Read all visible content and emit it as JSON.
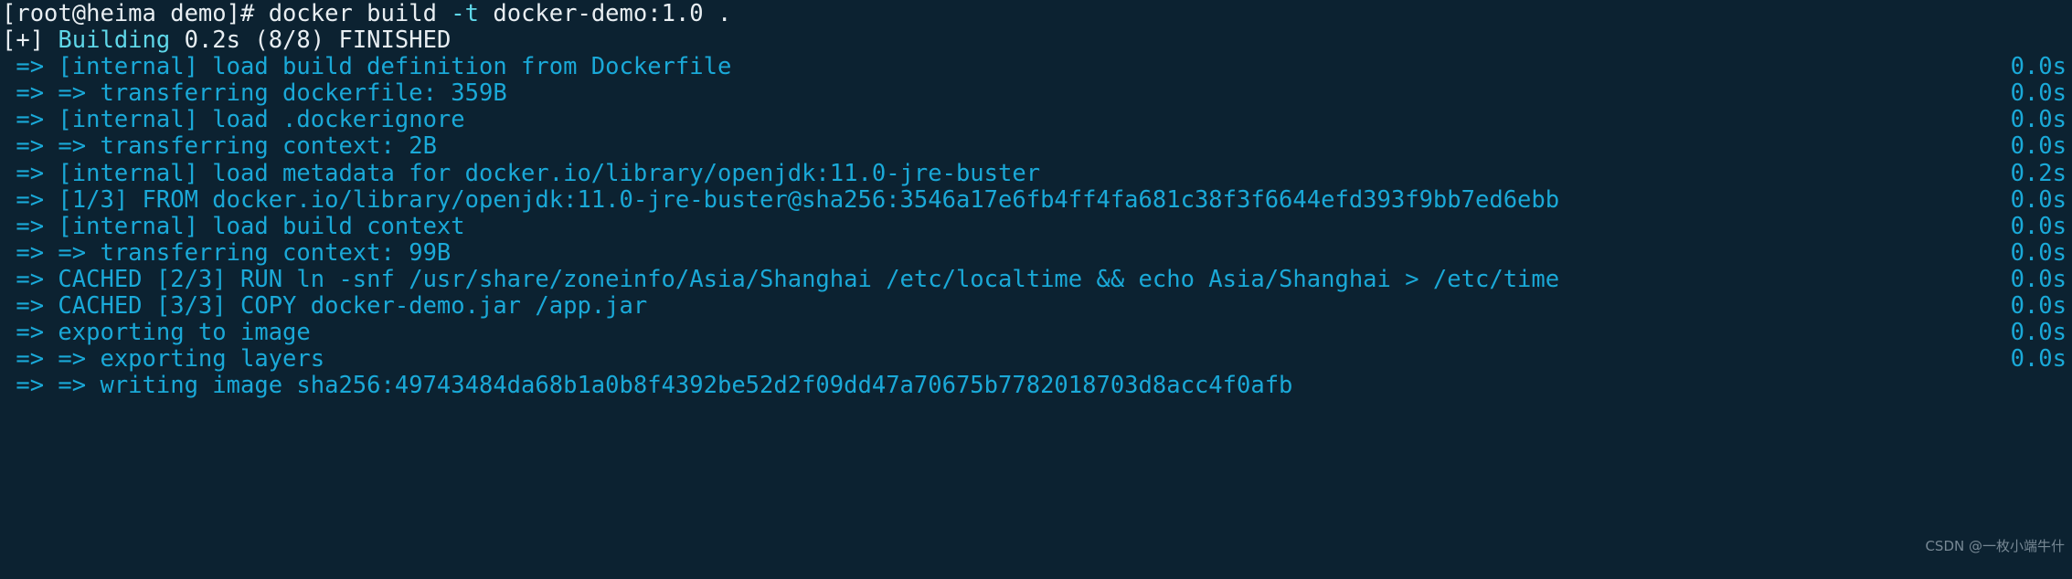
{
  "terminal": {
    "background_color": "#0c2231",
    "prompt_color": "#e8eef2",
    "step_color": "#1aa9d8",
    "accent_color": "#5fd7e8",
    "watermark": "CSDN @一枚小端牛什",
    "watermark_color": "#8a9aa6"
  },
  "command_line": {
    "prompt": "[root@heima demo]# ",
    "command": "docker build ",
    "flag": "-t",
    "args": " docker-demo:1.0 ."
  },
  "status_line": {
    "marker": "[+] ",
    "verb": "Building",
    "detail": " 0.2s (8/8) FINISHED"
  },
  "build_steps": [
    {
      "text": " => [internal] load build definition from Dockerfile",
      "time": "0.0s"
    },
    {
      "text": " => => transferring dockerfile: 359B",
      "time": "0.0s"
    },
    {
      "text": " => [internal] load .dockerignore",
      "time": "0.0s"
    },
    {
      "text": " => => transferring context: 2B",
      "time": "0.0s"
    },
    {
      "text": " => [internal] load metadata for docker.io/library/openjdk:11.0-jre-buster",
      "time": "0.2s"
    },
    {
      "text": " => [1/3] FROM docker.io/library/openjdk:11.0-jre-buster@sha256:3546a17e6fb4ff4fa681c38f3f6644efd393f9bb7ed6ebb",
      "time": "0.0s"
    },
    {
      "text": " => [internal] load build context",
      "time": "0.0s"
    },
    {
      "text": " => => transferring context: 99B",
      "time": "0.0s"
    },
    {
      "text": " => CACHED [2/3] RUN ln -snf /usr/share/zoneinfo/Asia/Shanghai /etc/localtime && echo Asia/Shanghai > /etc/time",
      "time": "0.0s"
    },
    {
      "text": " => CACHED [3/3] COPY docker-demo.jar /app.jar",
      "time": "0.0s"
    },
    {
      "text": " => exporting to image",
      "time": "0.0s"
    },
    {
      "text": " => => exporting layers",
      "time": "0.0s"
    },
    {
      "text": " => => writing image sha256:49743484da68b1a0b8f4392be52d2f09dd47a70675b7782018703d8acc4f0afb",
      "time": ""
    }
  ]
}
